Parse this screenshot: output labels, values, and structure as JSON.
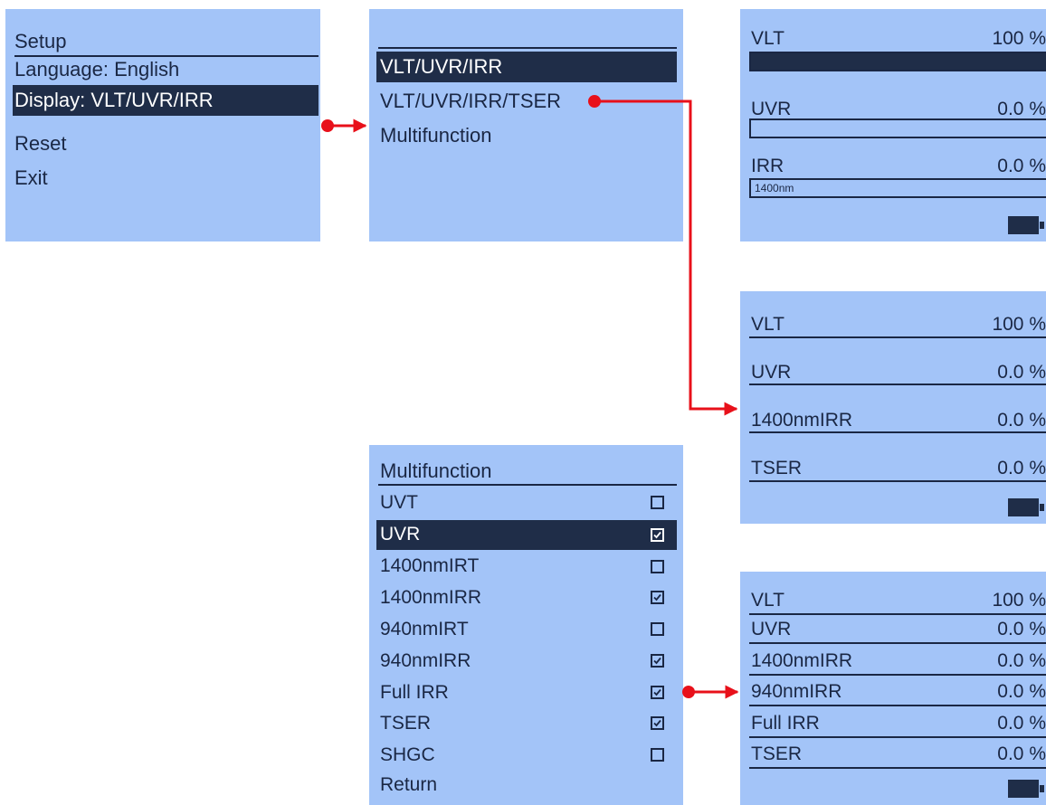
{
  "setup_menu": {
    "title": "Setup",
    "items": [
      "Language: English",
      "Display: VLT/UVR/IRR",
      "Reset",
      "Exit"
    ],
    "selected_index": 1
  },
  "display_menu": {
    "items": [
      "VLT/UVR/IRR",
      "VLT/UVR/IRR/TSER",
      "Multifunction"
    ],
    "selected_index": 0
  },
  "readout_bars": {
    "rows": [
      {
        "label": "VLT",
        "value": "100 %",
        "fill": 1.0,
        "caption": ""
      },
      {
        "label": "UVR",
        "value": "0.0 %",
        "fill": 0.0,
        "caption": ""
      },
      {
        "label": "IRR",
        "value": "0.0 %",
        "fill": 0.0,
        "caption": "1400nm"
      }
    ],
    "battery_icon": "battery-full-icon"
  },
  "readout_tser": {
    "rows": [
      {
        "label": "VLT",
        "value": "100 %"
      },
      {
        "label": "UVR",
        "value": "0.0 %"
      },
      {
        "label": "1400nmIRR",
        "value": "0.0 %"
      },
      {
        "label": "TSER",
        "value": "0.0 %"
      }
    ],
    "battery_icon": "battery-full-icon"
  },
  "multifunction_menu": {
    "title": "Multifunction",
    "items": [
      {
        "label": "UVT",
        "checked": false
      },
      {
        "label": "UVR",
        "checked": true
      },
      {
        "label": "1400nmIRT",
        "checked": false
      },
      {
        "label": "1400nmIRR",
        "checked": true
      },
      {
        "label": "940nmIRT",
        "checked": false
      },
      {
        "label": "940nmIRR",
        "checked": true
      },
      {
        "label": "Full IRR",
        "checked": true
      },
      {
        "label": "TSER",
        "checked": true
      },
      {
        "label": "SHGC",
        "checked": false
      }
    ],
    "return_label": "Return",
    "selected_index": 1
  },
  "readout_multi": {
    "rows": [
      {
        "label": "VLT",
        "value": "100 %"
      },
      {
        "label": "UVR",
        "value": "0.0 %"
      },
      {
        "label": "1400nmIRR",
        "value": "0.0 %"
      },
      {
        "label": "940nmIRR",
        "value": "0.0 %"
      },
      {
        "label": "Full IRR",
        "value": "0.0 %"
      },
      {
        "label": "TSER",
        "value": "0.0 %"
      }
    ],
    "battery_icon": "battery-full-icon"
  },
  "colors": {
    "panel_bg": "#a3c4f8",
    "selection_bg": "#1f2d48",
    "text": "#1a2744",
    "arrow": "#e8101a"
  }
}
